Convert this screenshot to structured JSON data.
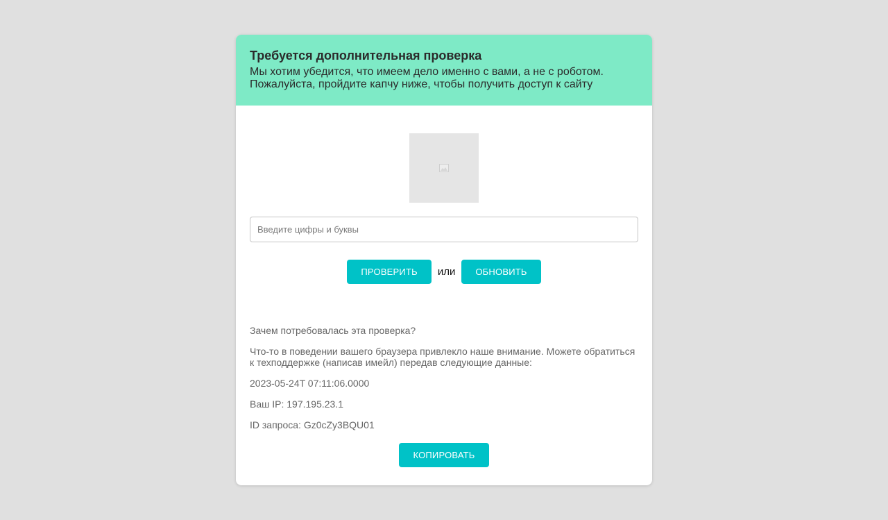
{
  "header": {
    "title": "Требуется дополнительная проверка",
    "line1": "Мы хотим убедится, что имеем дело именно с вами, а не с роботом.",
    "line2": "Пожалуйста, пройдите капчу ниже, чтобы получить доступ к сайту"
  },
  "captcha": {
    "image_icon": "broken-image-icon",
    "input_placeholder": "Введите цифры и буквы",
    "input_value": ""
  },
  "actions": {
    "check_label": "ПРОВЕРИТЬ",
    "or_label": "или",
    "refresh_label": "ОБНОВИТЬ"
  },
  "info": {
    "question": "Зачем потребовалась эта проверка?",
    "explanation": "Что-то в поведении вашего браузера привлекло наше внимание. Можете обратиться к техподдержке (написав имейл) передав следующие данные:",
    "timestamp": "2023-05-24T 07:11:06.0000",
    "ip": "Ваш IP: 197.195.23.1",
    "request_id": "ID запроса: Gz0cZy3BQU01",
    "copy_label": "КОПИРОВАТЬ"
  },
  "colors": {
    "page_bg": "#e0e0e0",
    "header_bg": "#7eeac6",
    "button_bg": "#00c2c7",
    "info_text": "#666666"
  }
}
